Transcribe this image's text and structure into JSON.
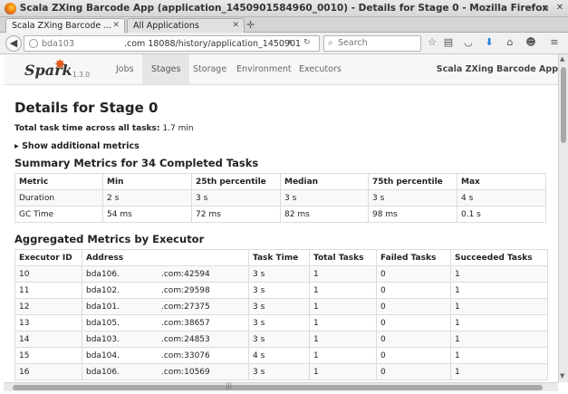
{
  "window": {
    "title": "Scala ZXing Barcode App (application_1450901584960_0010) - Details for Stage 0 - Mozilla Firefox"
  },
  "tabs": [
    {
      "label": "Scala ZXing Barcode ...",
      "active": true
    },
    {
      "label": "All Applications",
      "active": false
    }
  ],
  "navbar": {
    "url_host_prefix": "bda103",
    "url_rest": ".com 18088/history/application_1450901",
    "search_placeholder": "Search"
  },
  "spark": {
    "logo": "Spark",
    "version": "1.3.0",
    "nav": [
      "Jobs",
      "Stages",
      "Storage",
      "Environment",
      "Executors"
    ],
    "active_nav": "Stages",
    "app_name": "Scala ZXing Barcode App"
  },
  "page": {
    "title": "Details for Stage 0",
    "total_label": "Total task time across all tasks:",
    "total_value": "1.7 min",
    "show_metrics": "Show additional metrics",
    "summary_title": "Summary Metrics for 34 Completed Tasks",
    "aggregated_title": "Aggregated Metrics by Executor"
  },
  "summary": {
    "headers": [
      "Metric",
      "Min",
      "25th percentile",
      "Median",
      "75th percentile",
      "Max"
    ],
    "rows": [
      [
        "Duration",
        "2 s",
        "3 s",
        "3 s",
        "3 s",
        "4 s"
      ],
      [
        "GC Time",
        "54 ms",
        "72 ms",
        "82 ms",
        "98 ms",
        "0.1 s"
      ]
    ]
  },
  "executors": {
    "headers": [
      "Executor ID",
      "Address",
      "Task Time",
      "Total Tasks",
      "Failed Tasks",
      "Succeeded Tasks"
    ],
    "rows": [
      [
        "10",
        "bda106.",
        ".com:42594",
        "3 s",
        "1",
        "0",
        "1"
      ],
      [
        "11",
        "bda102.",
        ".com:29598",
        "3 s",
        "1",
        "0",
        "1"
      ],
      [
        "12",
        "bda101.",
        ".com:27375",
        "3 s",
        "1",
        "0",
        "1"
      ],
      [
        "13",
        "bda105.",
        ".com:38657",
        "3 s",
        "1",
        "0",
        "1"
      ],
      [
        "14",
        "bda103.",
        ".com:24853",
        "3 s",
        "1",
        "0",
        "1"
      ],
      [
        "15",
        "bda104.",
        ".com:33076",
        "4 s",
        "1",
        "0",
        "1"
      ],
      [
        "16",
        "bda106.",
        ".com:10569",
        "3 s",
        "1",
        "0",
        "1"
      ]
    ]
  }
}
